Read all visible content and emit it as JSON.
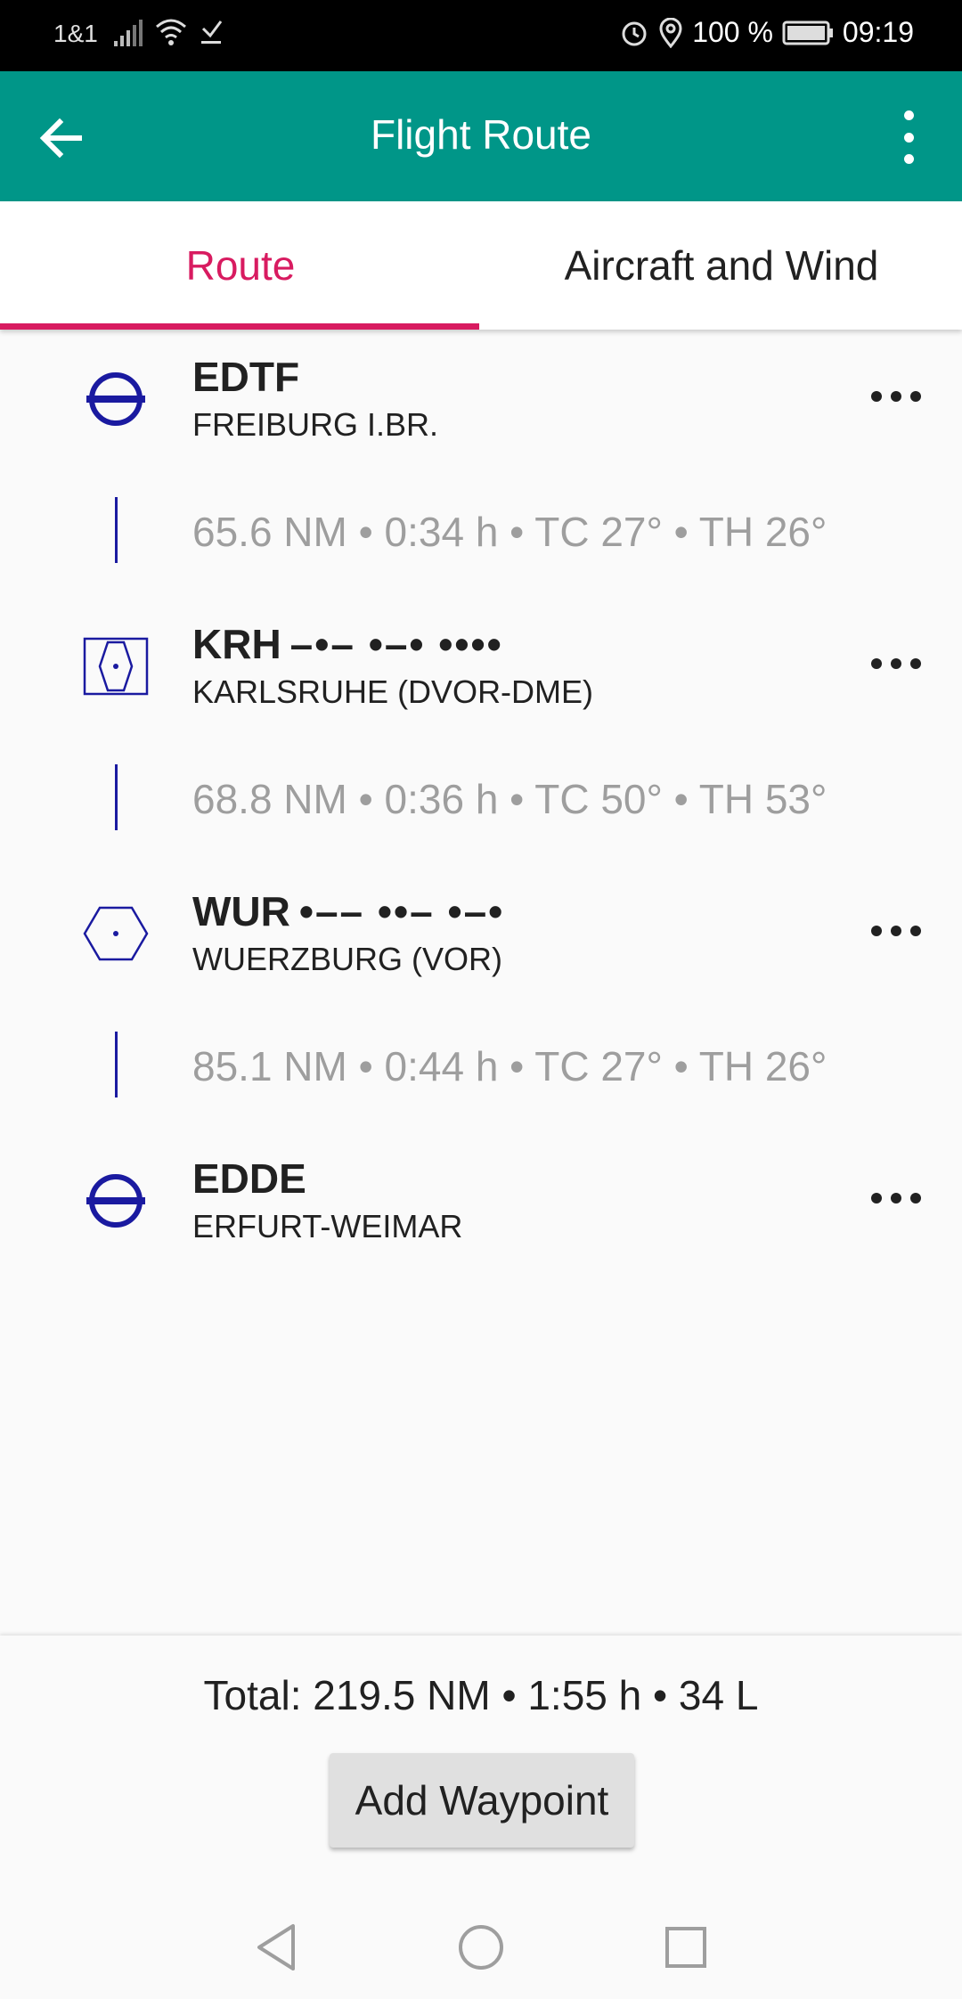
{
  "status_bar": {
    "carrier": "1&1",
    "battery": "100 %",
    "time": "09:19",
    "icons": [
      "signal-icon",
      "wifi-icon",
      "download-icon",
      "alarm-icon",
      "location-icon",
      "battery-icon"
    ]
  },
  "app_bar": {
    "title": "Flight Route",
    "back_icon": "arrow-back-icon",
    "overflow_icon": "more-vert-icon",
    "background": "#009688"
  },
  "tabs": [
    {
      "label": "Route",
      "active": true
    },
    {
      "label": "Aircraft and Wind",
      "active": false
    }
  ],
  "accent_color": "#d81b60",
  "route": {
    "waypoints": [
      {
        "code": "EDTF",
        "morse": "",
        "name": "FREIBURG I.BR.",
        "type": "airport",
        "icon": "airport-icon"
      },
      {
        "code": "KRH",
        "morse": "–•– •–• ••••",
        "name": "KARLSRUHE (DVOR-DME)",
        "type": "dvor-dme",
        "icon": "dvor-dme-icon"
      },
      {
        "code": "WUR",
        "morse": "•–– ••– •–•",
        "name": "WUERZBURG (VOR)",
        "type": "vor",
        "icon": "vor-icon"
      },
      {
        "code": "EDDE",
        "morse": "",
        "name": "ERFURT-WEIMAR",
        "type": "airport",
        "icon": "airport-icon"
      }
    ],
    "legs": [
      "65.6 NM • 0:34 h • TC 27° • TH 26°",
      "68.8 NM • 0:36 h • TC 50° • TH 53°",
      "85.1 NM • 0:44 h • TC 27° • TH 26°"
    ]
  },
  "footer": {
    "total": "Total: 219.5 NM • 1:55 h • 34 L",
    "add_button": "Add Waypoint"
  },
  "nav_bar": {
    "icons": [
      "nav-back-icon",
      "nav-home-icon",
      "nav-recents-icon"
    ]
  }
}
